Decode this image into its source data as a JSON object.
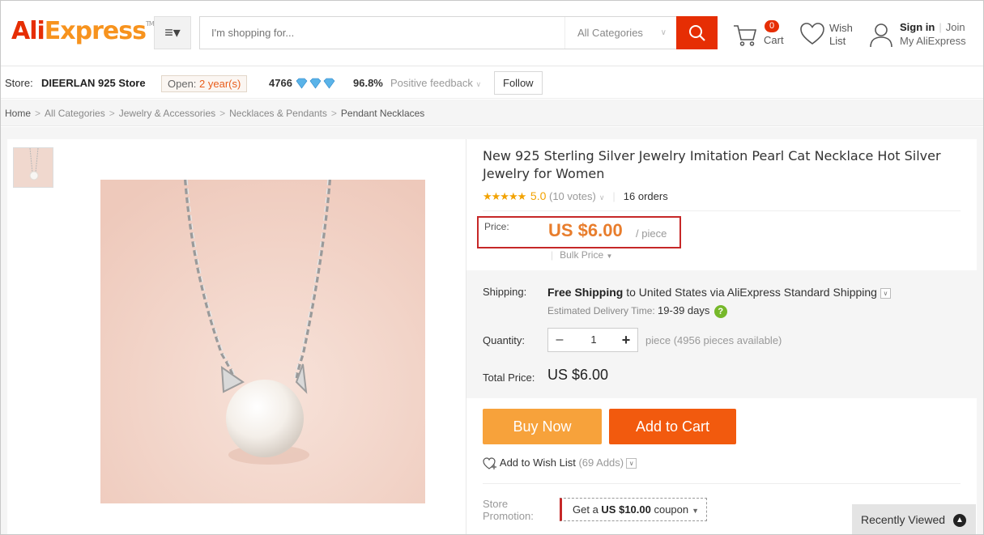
{
  "header": {
    "logo_a": "Ali",
    "logo_b": "Express",
    "logo_tm": "TM",
    "search_placeholder": "I'm shopping for...",
    "category": "All Categories",
    "cart_count": "0",
    "cart_label": "Cart",
    "wish_line1": "Wish",
    "wish_line2": "List",
    "signin": "Sign in",
    "join": "Join",
    "my_account": "My AliExpress"
  },
  "store": {
    "label": "Store:",
    "name": "DIEERLAN 925 Store",
    "open_prefix": "Open:",
    "open_years": "2 year(s)",
    "score": "4766",
    "feedback_pct": "96.8%",
    "feedback_label": "Positive feedback",
    "follow": "Follow"
  },
  "breadcrumb": [
    "Home",
    "All Categories",
    "Jewelry & Accessories",
    "Necklaces & Pendants",
    "Pendant Necklaces"
  ],
  "product": {
    "title": "New 925 Sterling Silver Jewelry Imitation Pearl Cat Necklace Hot Silver Jewelry for Women",
    "stars": "★★★★★",
    "rating": "5.0",
    "votes": "(10 votes)",
    "orders": "16 orders",
    "price_label": "Price:",
    "price": "US $6.00",
    "unit": "/ piece",
    "bulk": "Bulk Price",
    "shipping_label": "Shipping:",
    "shipping_free": "Free Shipping",
    "shipping_rest": " to United States via AliExpress Standard Shipping",
    "est_label": "Estimated Delivery Time:",
    "est_days": "19-39 days",
    "quantity_label": "Quantity:",
    "quantity_value": "1",
    "availability": "piece (4956 pieces available)",
    "total_label": "Total Price:",
    "total": "US $6.00",
    "buy_now": "Buy Now",
    "add_to_cart": "Add to Cart",
    "wish_add": "Add to Wish List",
    "wish_adds": "(69 Adds)",
    "promo_label_1": "Store",
    "promo_label_2": "Promotion:",
    "coupon_prefix": "Get a ",
    "coupon_value": "US $10.00",
    "coupon_suffix": " coupon"
  },
  "recently_viewed": "Recently Viewed",
  "colors": {
    "brand_red": "#e62e04",
    "brand_orange": "#f7931e",
    "buy_now": "#f7a23b",
    "add_to_cart": "#f25a0e",
    "price": "#e87d2c",
    "highlight_box": "#c62828"
  }
}
